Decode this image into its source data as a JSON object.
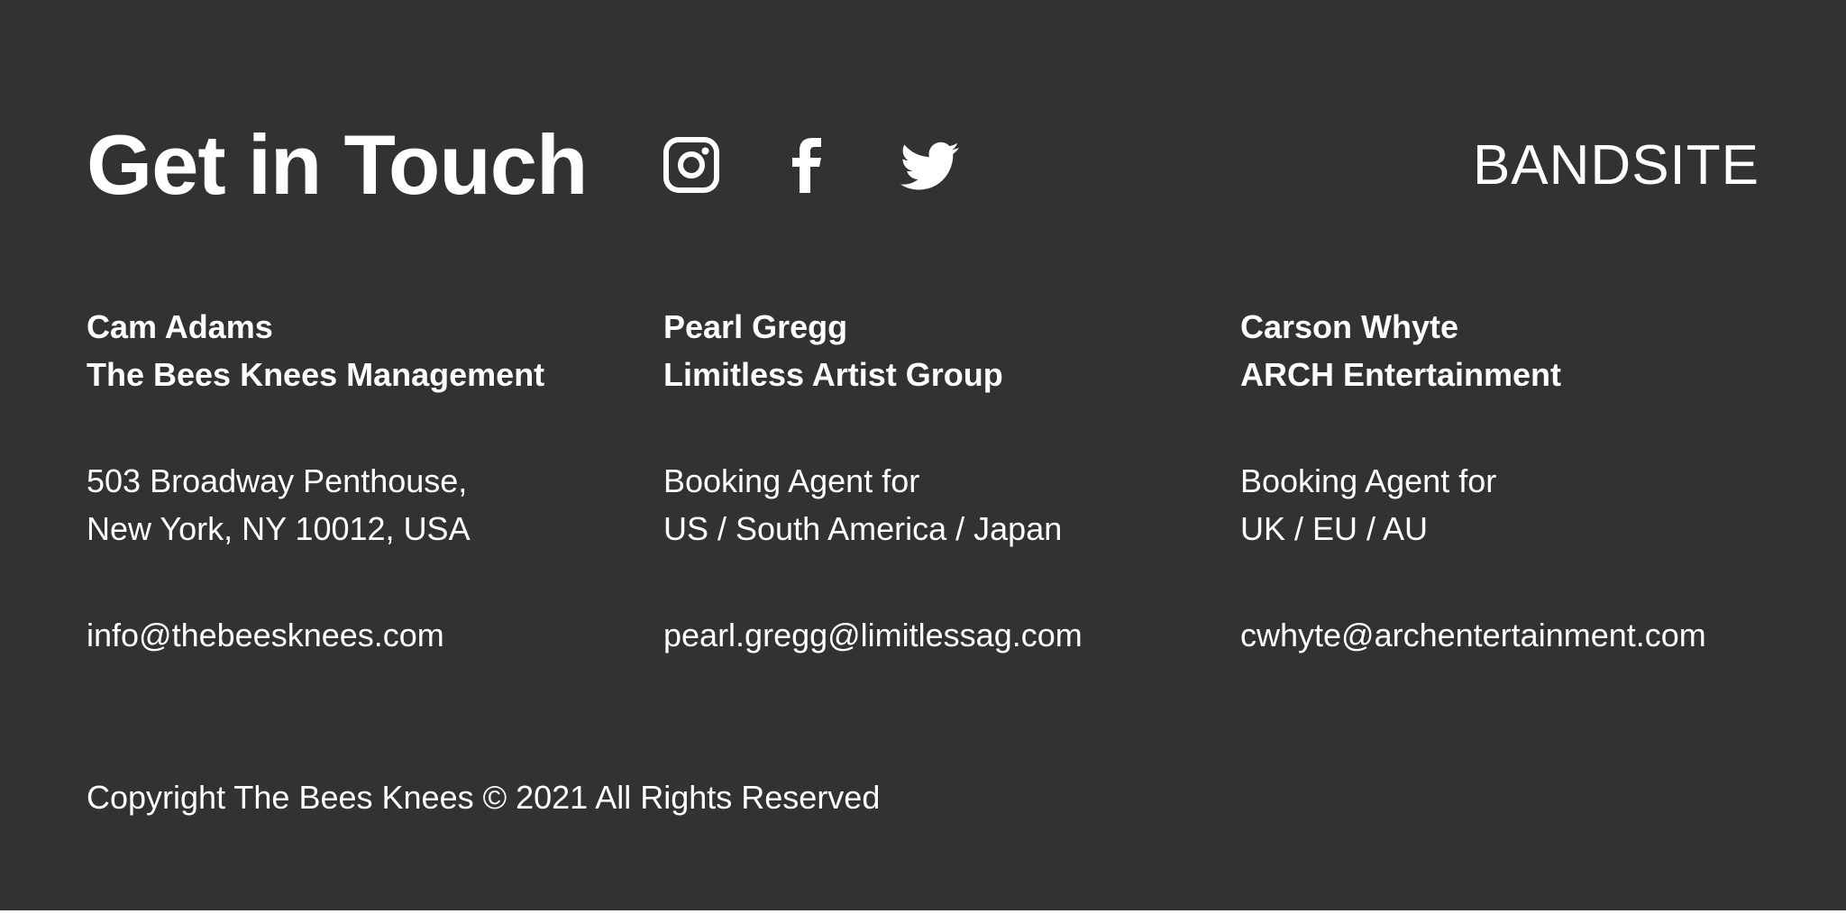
{
  "heading": "Get in Touch",
  "brand": "BANDSITE",
  "social": {
    "instagram": "instagram-icon",
    "facebook": "facebook-icon",
    "twitter": "twitter-icon"
  },
  "contacts": [
    {
      "name": "Cam Adams",
      "company": "The Bees Knees Management",
      "detail_line1": "503 Broadway Penthouse,",
      "detail_line2": "New York, NY 10012, USA",
      "email": "info@thebeesknees.com"
    },
    {
      "name": "Pearl Gregg",
      "company": "Limitless Artist Group",
      "detail_line1": "Booking Agent for",
      "detail_line2": "US / South America / Japan",
      "email": "pearl.gregg@limitlessag.com"
    },
    {
      "name": "Carson Whyte",
      "company": "ARCH Entertainment",
      "detail_line1": "Booking Agent for",
      "detail_line2": "UK / EU / AU",
      "email": "cwhyte@archentertainment.com"
    }
  ],
  "copyright": "Copyright The Bees Knees © 2021 All Rights Reserved",
  "colors": {
    "background": "#323232",
    "text": "#ffffff"
  }
}
